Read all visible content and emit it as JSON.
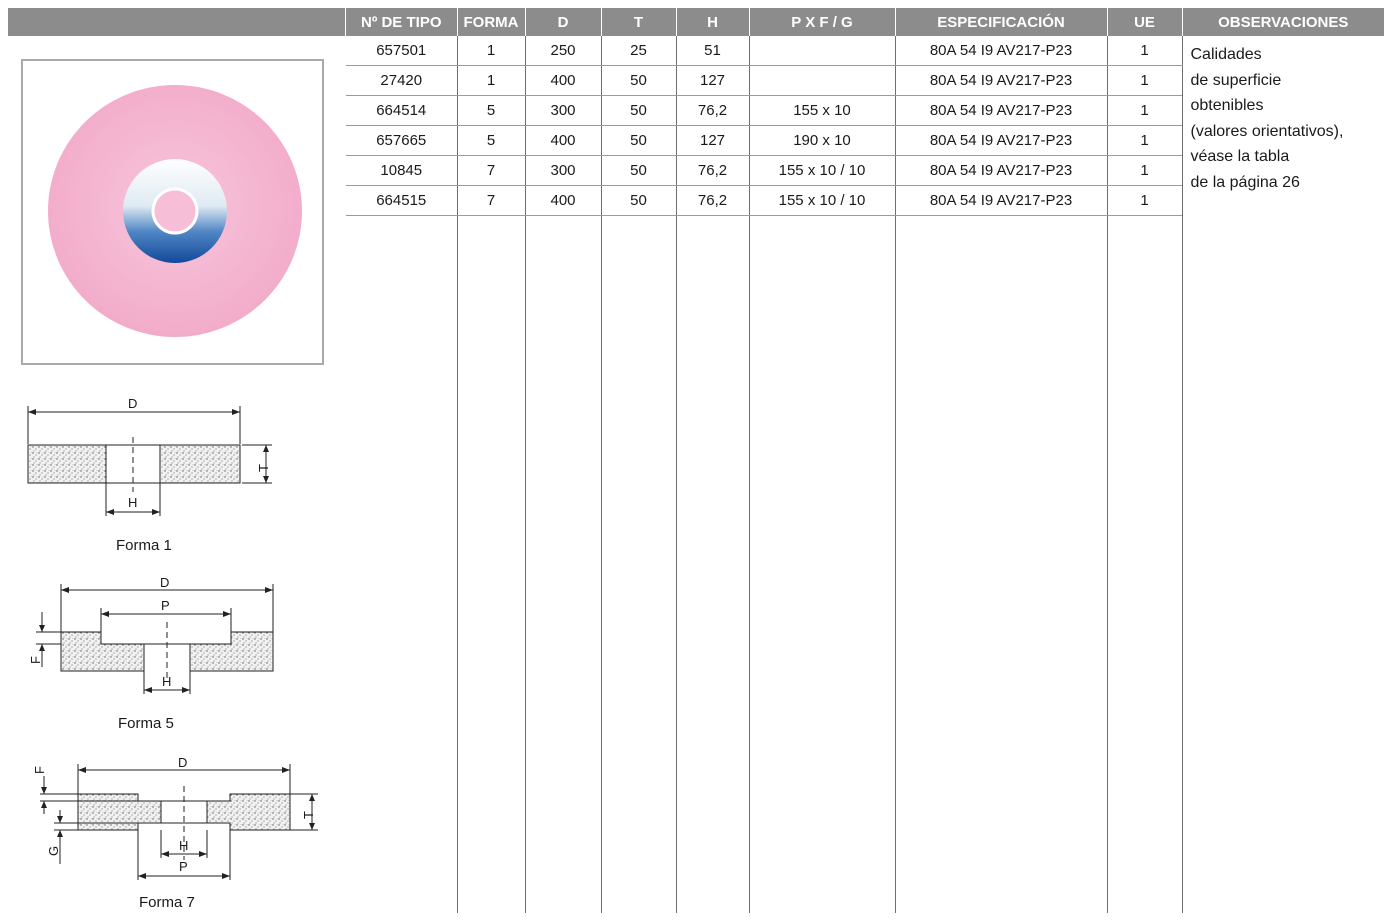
{
  "table": {
    "headers": {
      "tipo": "Nº DE TIPO",
      "forma": "FORMA",
      "d": "D",
      "t": "T",
      "h": "H",
      "pxfg": "P X F / G",
      "spec": "ESPECIFICACIÓN",
      "ue": "UE",
      "obs": "OBSERVACIONES"
    },
    "rows": [
      {
        "tipo": "657501",
        "forma": "1",
        "d": "250",
        "t": "25",
        "h": "51",
        "pxfg": "",
        "spec": "80A 54 I9 AV217-P23",
        "ue": "1"
      },
      {
        "tipo": "27420",
        "forma": "1",
        "d": "400",
        "t": "50",
        "h": "127",
        "pxfg": "",
        "spec": "80A 54 I9 AV217-P23",
        "ue": "1"
      },
      {
        "tipo": "664514",
        "forma": "5",
        "d": "300",
        "t": "50",
        "h": "76,2",
        "pxfg": "155 x 10",
        "spec": "80A 54 I9 AV217-P23",
        "ue": "1"
      },
      {
        "tipo": "657665",
        "forma": "5",
        "d": "400",
        "t": "50",
        "h": "127",
        "pxfg": "190 x 10",
        "spec": "80A 54 I9 AV217-P23",
        "ue": "1"
      },
      {
        "tipo": "10845",
        "forma": "7",
        "d": "300",
        "t": "50",
        "h": "76,2",
        "pxfg": "155 x 10 / 10",
        "spec": "80A 54 I9 AV217-P23",
        "ue": "1"
      },
      {
        "tipo": "664515",
        "forma": "7",
        "d": "400",
        "t": "50",
        "h": "76,2",
        "pxfg": "155 x 10 / 10",
        "spec": "80A 54 I9 AV217-P23",
        "ue": "1"
      }
    ],
    "observations": [
      "Calidades",
      "de superficie",
      "obtenibles",
      "(valores orientativos),",
      "véase la tabla",
      "de la página 26"
    ]
  },
  "figures": {
    "forma1": {
      "label": "Forma 1",
      "d": "D",
      "t": "T",
      "h": "H"
    },
    "forma5": {
      "label": "Forma 5",
      "d": "D",
      "p": "P",
      "f": "F",
      "h": "H"
    },
    "forma7": {
      "label": "Forma 7",
      "f": "F",
      "d": "D",
      "t": "T",
      "g": "G",
      "h": "H",
      "p": "P"
    }
  },
  "colors": {
    "header_bg": "#8c8c8c",
    "header_text": "#ffffff",
    "wheel_pink": "#f4b3d0",
    "hub_blue": "#1f5fae"
  }
}
